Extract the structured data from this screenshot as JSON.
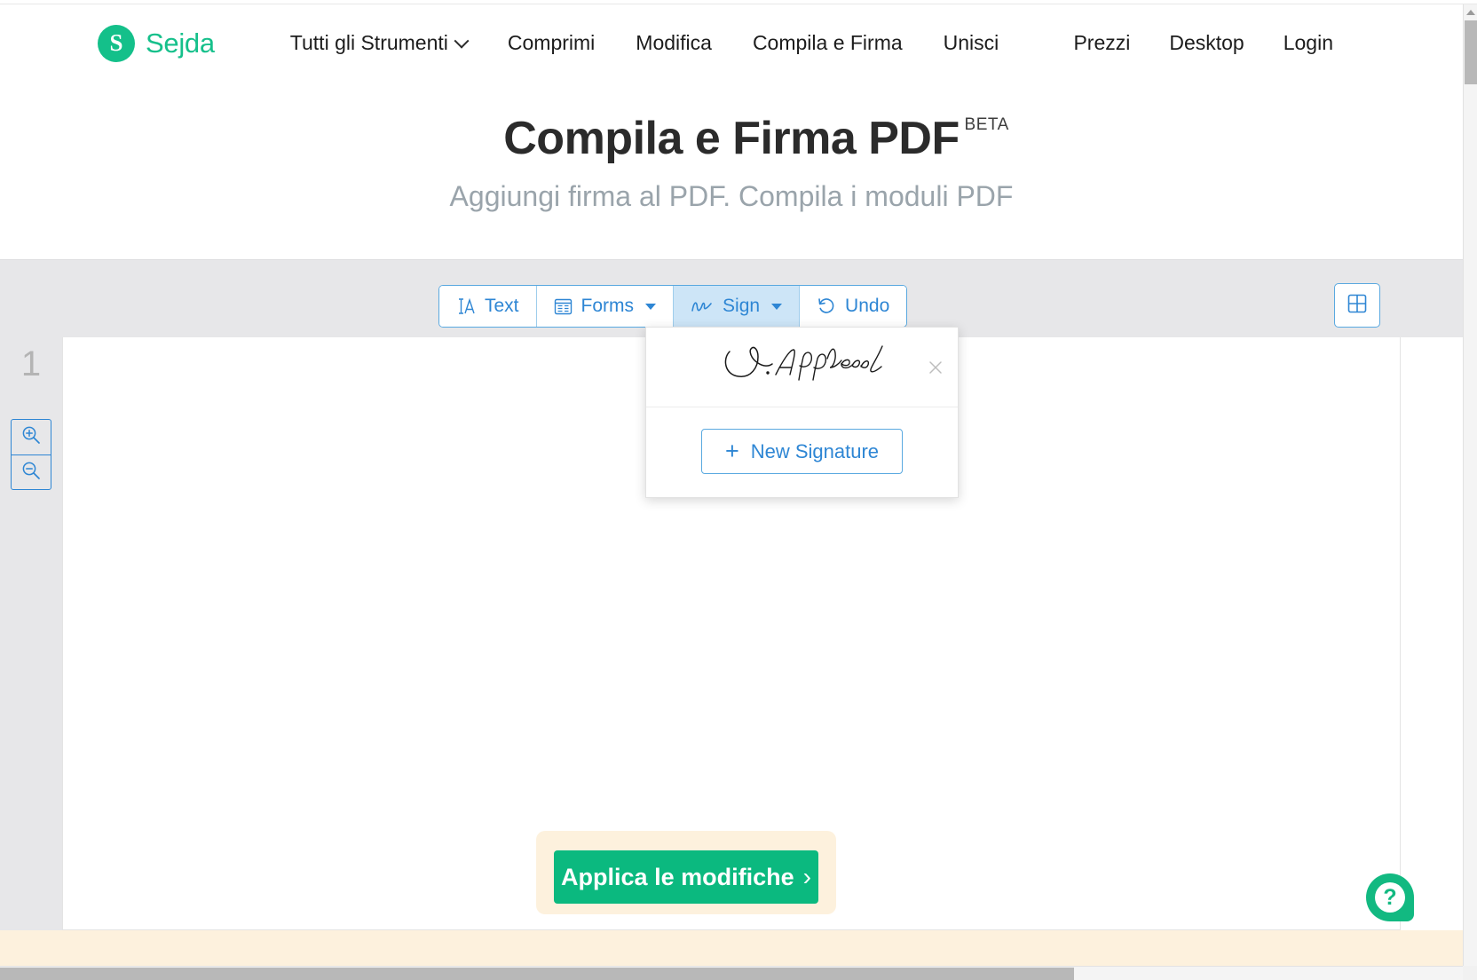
{
  "brand": {
    "mark_letter": "S",
    "name": "Sejda",
    "accent_color": "#16c08b"
  },
  "nav": {
    "left_items": [
      {
        "label": "Tutti gli Strumenti",
        "has_caret": true,
        "icon": "chevron-down-icon"
      },
      {
        "label": "Comprimi",
        "has_caret": false,
        "icon": ""
      },
      {
        "label": "Modifica",
        "has_caret": false,
        "icon": ""
      },
      {
        "label": "Compila e Firma",
        "has_caret": false,
        "icon": ""
      },
      {
        "label": "Unisci",
        "has_caret": false,
        "icon": ""
      }
    ],
    "right_items": [
      {
        "label": "Prezzi"
      },
      {
        "label": "Desktop"
      },
      {
        "label": "Login"
      }
    ]
  },
  "hero": {
    "title": "Compila e Firma PDF",
    "badge": "BETA",
    "subtitle": "Aggiungi firma al PDF. Compila i moduli PDF"
  },
  "toolbar": {
    "buttons": [
      {
        "label": "Text",
        "icon": "text-cursor-icon",
        "has_caret": false,
        "active": false
      },
      {
        "label": "Forms",
        "icon": "form-icon",
        "has_caret": true,
        "active": false
      },
      {
        "label": "Sign",
        "icon": "signature-icon",
        "has_caret": true,
        "active": true
      },
      {
        "label": "Undo",
        "icon": "undo-icon",
        "has_caret": false,
        "active": false
      }
    ],
    "thumbnails_icon": "grid-icon",
    "accent_color": "#2e86d4",
    "active_bg": "#cde5f7",
    "bar_bg": "#e7e7e9"
  },
  "signature_dropdown": {
    "visible": true,
    "saved_signature_name": "J. Appleseed",
    "saved_signature_icon": "signature-preview",
    "close_icon": "close-icon",
    "new_signature_label": "New Signature",
    "new_signature_plus": "+"
  },
  "viewer": {
    "page_number": "1",
    "zoom_in_icon": "zoom-in-icon",
    "zoom_out_icon": "zoom-out-icon",
    "canvas_bg": "#ffffff",
    "rail_bg": "#e7e7e9"
  },
  "footer": {
    "apply_label": "Applica le modifiche",
    "apply_chevron": "›",
    "apply_color": "#0bb97f",
    "band_color": "#fdf1dd"
  },
  "help": {
    "icon": "question-mark-icon",
    "glyph": "?",
    "color": "#12b981"
  },
  "scrollbars": {
    "vertical_arrow_icon": "scroll-up-arrow-icon",
    "vertical_present": true,
    "horizontal_present": true
  }
}
